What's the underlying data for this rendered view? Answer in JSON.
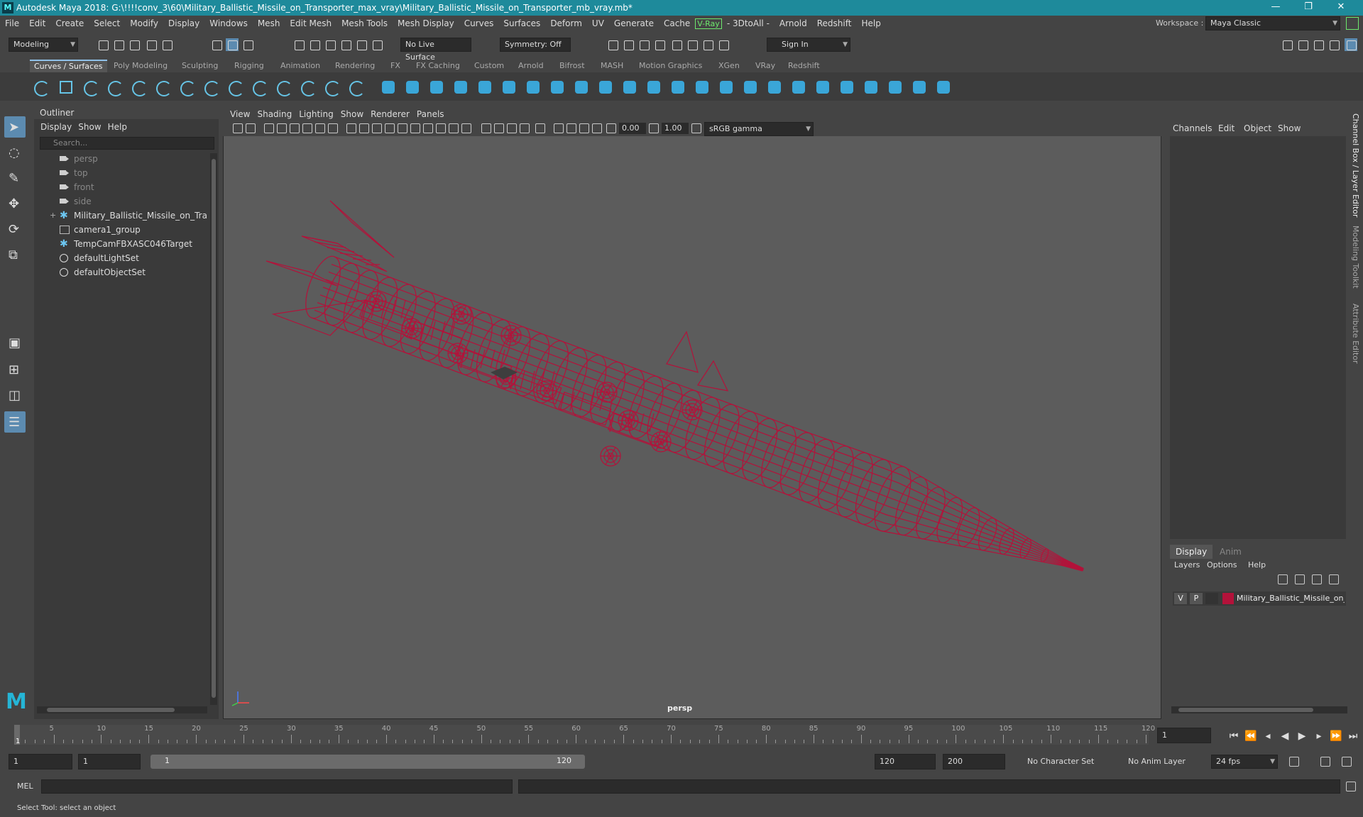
{
  "window": {
    "title": "Autodesk Maya 2018: G:\\!!!!conv_3\\60\\Military_Ballistic_Missile_on_Transporter_max_vray\\Military_Ballistic_Missile_on_Transporter_mb_vray.mb*",
    "logo": "M",
    "controls": [
      "—",
      "❐",
      "✕"
    ]
  },
  "menu": {
    "items": [
      "File",
      "Edit",
      "Create",
      "Select",
      "Modify",
      "Display",
      "Windows",
      "Mesh",
      "Edit Mesh",
      "Mesh Tools",
      "Mesh Display",
      "Curves",
      "Surfaces",
      "Deform",
      "UV",
      "Generate",
      "Cache"
    ],
    "vray": "V-Ray",
    "items2": [
      "- 3DtoAll -",
      "Arnold",
      "Redshift",
      "Help"
    ],
    "workspace_label": "Workspace :",
    "workspace_value": "Maya Classic"
  },
  "status": {
    "mode": "Modeling",
    "live_surface": "No Live Surface",
    "symmetry": "Symmetry: Off",
    "sign_in": "Sign In"
  },
  "shelf": {
    "tabs": [
      "Curves / Surfaces",
      "Poly Modeling",
      "Sculpting",
      "Rigging",
      "Animation",
      "Rendering",
      "FX",
      "FX Caching",
      "Custom",
      "Arnold",
      "Bifrost",
      "MASH",
      "Motion Graphics",
      "XGen",
      "VRay",
      "Redshift"
    ],
    "active": "Curves / Surfaces"
  },
  "outliner": {
    "title": "Outliner",
    "menu": [
      "Display",
      "Show",
      "Help"
    ],
    "search_placeholder": "Search...",
    "items": [
      {
        "label": "persp",
        "icon": "camera-icon",
        "dim": true
      },
      {
        "label": "top",
        "icon": "camera-icon",
        "dim": true
      },
      {
        "label": "front",
        "icon": "camera-icon",
        "dim": true
      },
      {
        "label": "side",
        "icon": "camera-icon",
        "dim": true
      },
      {
        "label": "Military_Ballistic_Missile_on_Transporter",
        "icon": "transform-icon",
        "dim": false,
        "expand": "+"
      },
      {
        "label": "camera1_group",
        "icon": "group-icon",
        "dim": false
      },
      {
        "label": "TempCamFBXASC046Target",
        "icon": "transform-icon",
        "dim": false
      },
      {
        "label": "defaultLightSet",
        "icon": "set-icon",
        "dim": false
      },
      {
        "label": "defaultObjectSet",
        "icon": "set-icon",
        "dim": false
      }
    ]
  },
  "viewport": {
    "menu": [
      "View",
      "Shading",
      "Lighting",
      "Show",
      "Renderer",
      "Panels"
    ],
    "near": "0.00",
    "far": "1.00",
    "color_space": "sRGB gamma",
    "camera": "persp",
    "wire_color": "#b3123a"
  },
  "channelbox": {
    "menu": [
      "Channels",
      "Edit",
      "Object",
      "Show"
    ],
    "side_tabs": [
      "Channel Box / Layer Editor",
      "Modeling Toolkit",
      "Attribute Editor"
    ]
  },
  "layers": {
    "tabs": [
      "Display",
      "Anim"
    ],
    "menu": [
      "Layers",
      "Options",
      "Help"
    ],
    "row": {
      "v": "V",
      "p": "P",
      "name": "Military_Ballistic_Missile_on_Transporter",
      "color": "#b3123a"
    }
  },
  "timeline": {
    "ticks": [
      "5",
      "10",
      "15",
      "20",
      "25",
      "30",
      "35",
      "40",
      "45",
      "50",
      "55",
      "60",
      "65",
      "70",
      "75",
      "80",
      "85",
      "90",
      "95",
      "100",
      "105",
      "110",
      "115",
      "120"
    ],
    "start_label": "1",
    "current_frame": "1",
    "range_start": "1",
    "range_start2": "1",
    "slider_start": "1",
    "slider_end": "120",
    "range_end": "120",
    "anim_end": "200",
    "character_set": "No Character Set",
    "anim_layer": "No Anim Layer",
    "fps": "24 fps",
    "play_controls": [
      "⏮",
      "⏪",
      "◂",
      "◀",
      "▶",
      "▸",
      "⏩",
      "⏭"
    ]
  },
  "command": {
    "label": "MEL",
    "help": "Select Tool: select an object"
  }
}
